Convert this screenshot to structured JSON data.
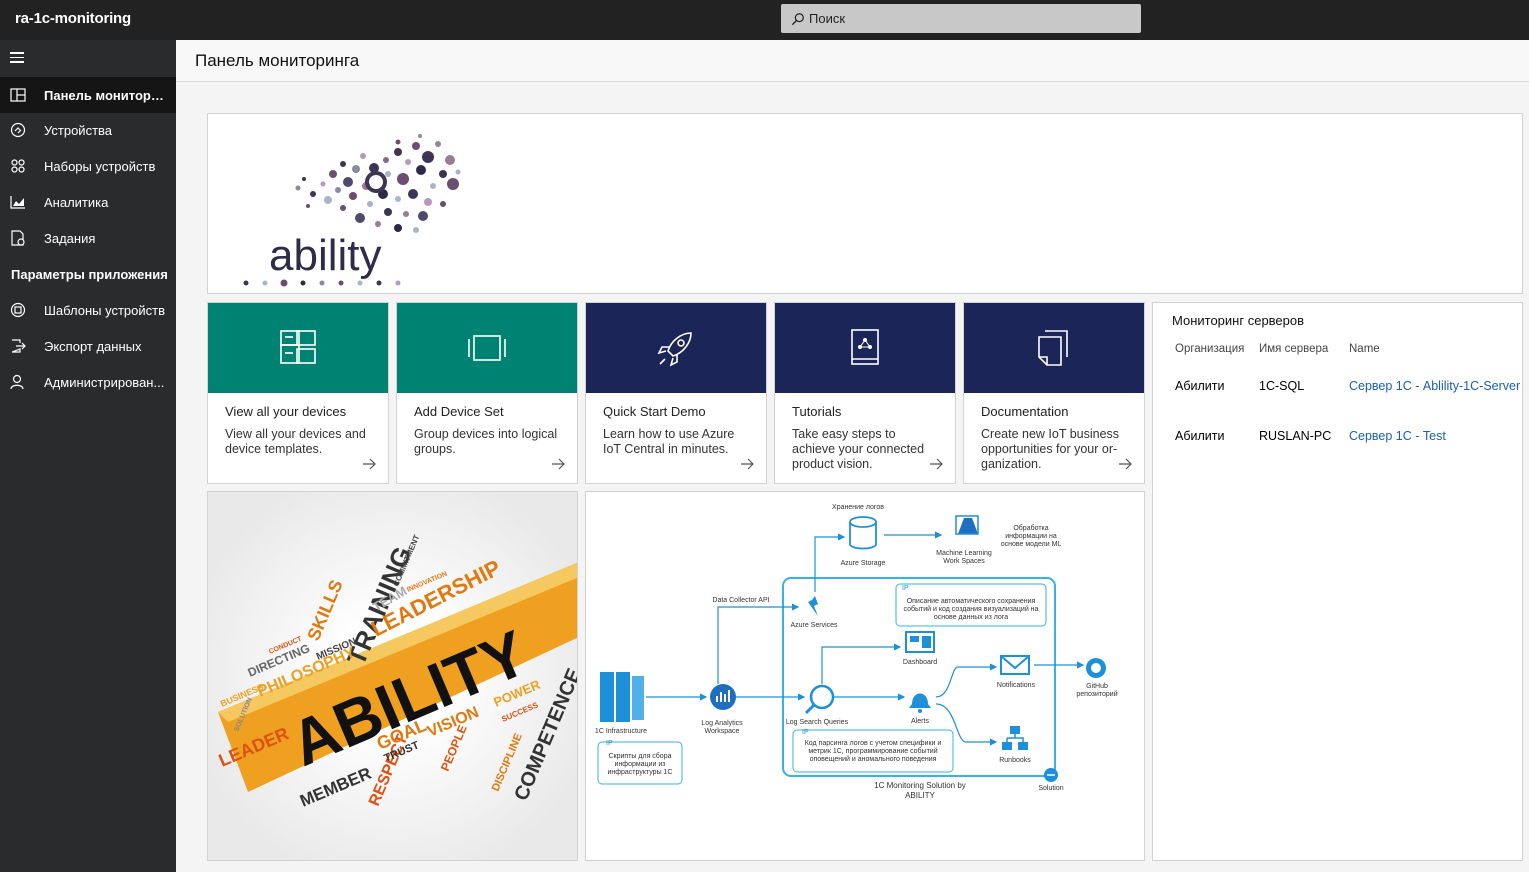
{
  "app": {
    "title": "ra-1c-monitoring"
  },
  "search": {
    "placeholder": "Поиск"
  },
  "sidebar": {
    "items": [
      {
        "label": "Панель монитори...",
        "icon": "dashboard-icon",
        "active": true
      },
      {
        "label": "Устройства",
        "icon": "devices-icon"
      },
      {
        "label": "Наборы устройств",
        "icon": "device-sets-icon"
      },
      {
        "label": "Аналитика",
        "icon": "analytics-icon"
      },
      {
        "label": "Задания",
        "icon": "jobs-icon"
      }
    ],
    "section_label": "Параметры приложения",
    "settings_items": [
      {
        "label": "Шаблоны устройств",
        "icon": "device-templates-icon"
      },
      {
        "label": "Экспорт данных",
        "icon": "data-export-icon"
      },
      {
        "label": "Администрирован...",
        "icon": "administration-icon"
      }
    ]
  },
  "page": {
    "title": "Панель мониторинга"
  },
  "logo": {
    "text": "ability"
  },
  "cards": [
    {
      "title": "View all your devices",
      "description": "View all your devices and device templates.",
      "icon": "devices-grid-icon",
      "color": "#008272"
    },
    {
      "title": "Add Device Set",
      "description": "Group devices into logical groups.",
      "icon": "device-set-icon",
      "color": "#008272"
    },
    {
      "title": "Quick Start Demo",
      "description": "Learn how to use Azure IoT Central in minutes.",
      "icon": "rocket-icon",
      "color": "#1b2557"
    },
    {
      "title": "Tutorials",
      "description": "Take easy steps to achieve your connected product vision.",
      "icon": "book-icon",
      "color": "#1b2557"
    },
    {
      "title": "Documentation",
      "description": "Create new IoT business opportunities for your or-ganization.",
      "icon": "documents-icon",
      "color": "#1b2557"
    }
  ],
  "servers": {
    "title": "Мониторинг серверов",
    "columns": [
      "Организация",
      "Имя сервера",
      "Name"
    ],
    "rows": [
      [
        "Абилити",
        "1C-SQL",
        "Сервер 1С - Ablility-1C-Server"
      ],
      [
        "Абилити",
        "RUSLAN-PC",
        "Сервер 1С - Test"
      ]
    ]
  },
  "wordcloud": {
    "main": "ABILITY",
    "words": [
      "TRAINING",
      "LEADERSHIP",
      "SKILLS",
      "TEAM",
      "PHILOSOPHY",
      "DIRECTING",
      "MISSION",
      "BUSINESS",
      "LEADER",
      "MEMBER",
      "RESPECT",
      "GOAL",
      "TRUST",
      "VISION",
      "PEOPLE",
      "COMPETENCE",
      "POWER",
      "DISCIPLINE",
      "SOLUTION",
      "COMMITMENT",
      "SUCCESS",
      "CONDUCT",
      "INNOVATION"
    ]
  },
  "diagram": {
    "labels": {
      "storage_title": "Хранение логов",
      "storage": "Azure Storage",
      "ml": "Machine Learning Work Spaces",
      "ml_note": "Обработка информации на основе модели ML",
      "collector": "Data Collector API",
      "services": "Azure Services",
      "ip_top": "IP",
      "ip_top_text": "Описание автоматического сохранения событий и код создания визуализаций на основе данных из лога",
      "dashboard": "Dashboard",
      "notifications": "Notifications",
      "github": "GitHub репозиторий",
      "infra": "1C Infrastructure",
      "workspace": "Log Analytics Workspace",
      "queries": "Log Search Queries",
      "alerts": "Alerts",
      "runbooks": "Runbooks",
      "ip_left": "IP",
      "ip_left_text": "Скрипты для сбора информации из инфраструктуры 1С",
      "ip_mid": "IP",
      "ip_mid_text": "Код парсинга логов с учетом специфики и метрик 1С, программирование событий оповещений и аномального поведения",
      "solution": "Solution",
      "caption": "1C Monitoring Solution by ABILITY"
    }
  },
  "colors": {
    "teal": "#008272",
    "navy": "#1b2557",
    "link": "#1a5fb4",
    "azure": "#1e90d8"
  }
}
